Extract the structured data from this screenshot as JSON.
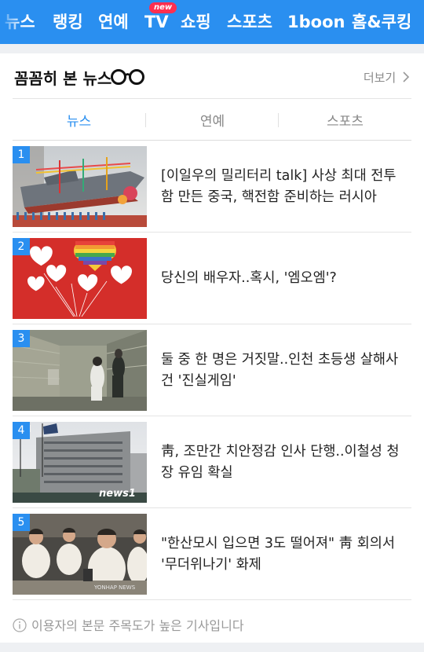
{
  "topnav": {
    "items": [
      "뉴스",
      "랭킹",
      "연예",
      "TV",
      "쇼핑",
      "스포츠",
      "1boon",
      "홈&쿠킹"
    ],
    "active_index": 1,
    "new_badge": "new",
    "bg_color": "#2a8ff0"
  },
  "section": {
    "title": "꼼꼼히 본 뉴스",
    "more_label": "더보기",
    "title_icon": "glasses-icon"
  },
  "tabs": {
    "items": [
      "뉴스",
      "연예",
      "스포츠"
    ],
    "active_index": 0,
    "active_color": "#2a8ff0"
  },
  "news": [
    {
      "rank": "1",
      "title": "[이일우의 밀리터리 talk] 사상 최대 전투함 만든 중국, 핵전함 준비하는 러시아"
    },
    {
      "rank": "2",
      "title": "당신의 배우자..혹시, '엠오엠'?"
    },
    {
      "rank": "3",
      "title": "둘 중 한 명은 거짓말..인천 초등생 살해사건 '진실게임'"
    },
    {
      "rank": "4",
      "title": "靑, 조만간 치안정감 인사 단행..이철성 청장 유임 확실"
    },
    {
      "rank": "5",
      "title": "\"한산모시 입으면 3도 떨어져\" 靑 회의서 '무더위나기' 화제"
    }
  ],
  "thumb_marks": {
    "news1_logo": "news1",
    "yonhap": "YONHAP NEWS"
  },
  "footer_note": "이용자의 본문 주목도가 높은 기사입니다"
}
